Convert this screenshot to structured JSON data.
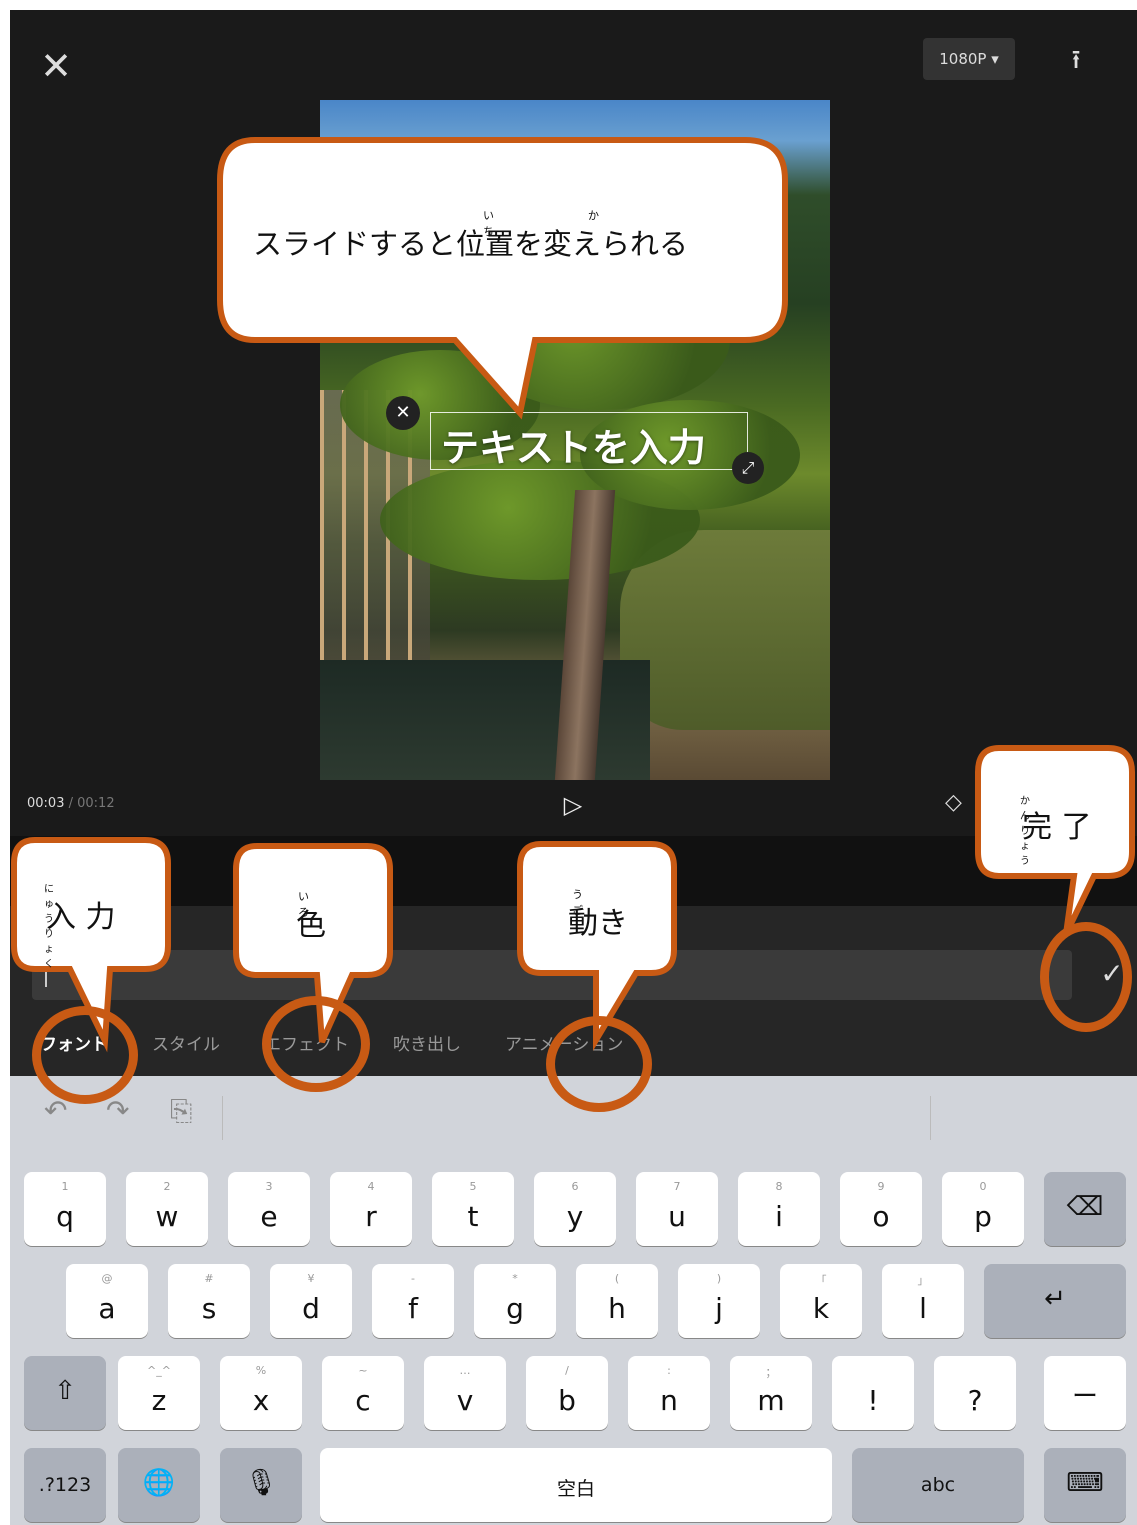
{
  "topbar": {
    "close": "✕",
    "resolution": "1080P ▾",
    "export": "⭱"
  },
  "preview": {
    "text_overlay": "テキストを入力"
  },
  "playback": {
    "current": "00:03",
    "duration": "/ 00:12"
  },
  "input": {
    "placeholder": "",
    "confirm": "✓"
  },
  "tabs": [
    "フォント",
    "スタイル",
    "エフェクト",
    "吹き出し",
    "アニメーション"
  ],
  "keyboard": {
    "row1": [
      {
        "k": "q",
        "h": "1"
      },
      {
        "k": "w",
        "h": "2"
      },
      {
        "k": "e",
        "h": "3"
      },
      {
        "k": "r",
        "h": "4"
      },
      {
        "k": "t",
        "h": "5"
      },
      {
        "k": "y",
        "h": "6"
      },
      {
        "k": "u",
        "h": "7"
      },
      {
        "k": "i",
        "h": "8"
      },
      {
        "k": "o",
        "h": "9"
      },
      {
        "k": "p",
        "h": "0"
      }
    ],
    "row2": [
      {
        "k": "a",
        "h": "@"
      },
      {
        "k": "s",
        "h": "#"
      },
      {
        "k": "d",
        "h": "¥"
      },
      {
        "k": "f",
        "h": "-"
      },
      {
        "k": "g",
        "h": "*"
      },
      {
        "k": "h",
        "h": "("
      },
      {
        "k": "j",
        "h": ")"
      },
      {
        "k": "k",
        "h": "「"
      },
      {
        "k": "l",
        "h": "」"
      }
    ],
    "row3": [
      {
        "k": "z",
        "h": "^_^"
      },
      {
        "k": "x",
        "h": "%"
      },
      {
        "k": "c",
        "h": "~"
      },
      {
        "k": "v",
        "h": "…"
      },
      {
        "k": "b",
        "h": "/"
      },
      {
        "k": "n",
        "h": ":"
      },
      {
        "k": "m",
        "h": "；"
      },
      {
        "k": "!",
        "h": ""
      },
      {
        "k": "?",
        "h": ""
      }
    ],
    "numbers": ".?123",
    "space": "空白",
    "abc": "abc",
    "dash": "ー"
  },
  "annotations": {
    "main_tip": "スライドすると位置を変えられる",
    "main_ruby_1": "い ち",
    "main_ruby_2": "か",
    "input_label": "入 力",
    "input_ruby": "にゅうりょく",
    "color_label": "色",
    "color_ruby": "いろ",
    "motion_label": "動き",
    "motion_ruby": "うご",
    "done_label": "完 了",
    "done_ruby": "かんりょう"
  },
  "colors": {
    "callout_border": "#c85a14",
    "panel": "#1a1a1a",
    "keyboard": "#d1d4da"
  }
}
